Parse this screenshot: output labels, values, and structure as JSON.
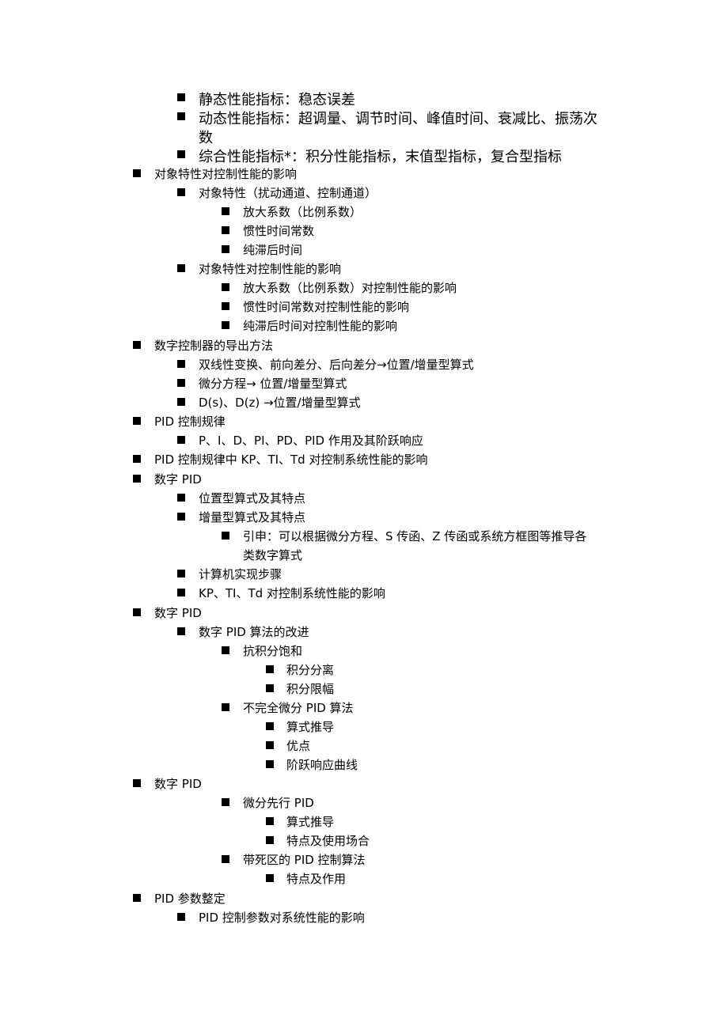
{
  "outline": [
    {
      "level": 2,
      "size": "big",
      "text": "静态性能指标：稳态误差"
    },
    {
      "level": 2,
      "size": "big",
      "text": "动态性能指标：超调量、调节时间、峰值时间、衰减比、振荡次",
      "continuation": "数"
    },
    {
      "level": 2,
      "size": "big",
      "text": "综合性能指标*：积分性能指标，末值型指标，复合型指标"
    },
    {
      "level": 1,
      "size": "small",
      "text": "对象特性对控制性能的影响"
    },
    {
      "level": 2,
      "size": "small",
      "text": "对象特性（扰动通道、控制通道）"
    },
    {
      "level": 3,
      "size": "small",
      "text": "放大系数（比例系数）"
    },
    {
      "level": 3,
      "size": "small",
      "text": "惯性时间常数"
    },
    {
      "level": 3,
      "size": "small",
      "text": "纯滞后时间"
    },
    {
      "level": 2,
      "size": "small",
      "text": "对象特性对控制性能的影响"
    },
    {
      "level": 3,
      "size": "small",
      "text": "放大系数（比例系数）对控制性能的影响"
    },
    {
      "level": 3,
      "size": "small",
      "text": "惯性时间常数对控制性能的影响"
    },
    {
      "level": 3,
      "size": "small",
      "text": "纯滞后时间对控制性能的影响"
    },
    {
      "level": 1,
      "size": "small",
      "text": "数字控制器的导出方法"
    },
    {
      "level": 2,
      "size": "small",
      "text": "双线性变换、前向差分、后向差分→位置/增量型算式"
    },
    {
      "level": 2,
      "size": "small",
      "text": "微分方程→ 位置/增量型算式"
    },
    {
      "level": 2,
      "size": "small",
      "text": "D(s)、D(z) →位置/增量型算式"
    },
    {
      "level": 1,
      "size": "small",
      "text": "PID 控制规律"
    },
    {
      "level": 2,
      "size": "small",
      "text": "P、I、D、PI、PD、PID 作用及其阶跃响应"
    },
    {
      "level": 1,
      "size": "small",
      "text": "PID 控制规律中 KP、TI、Td 对控制系统性能的影响"
    },
    {
      "level": 1,
      "size": "small",
      "text": "数字 PID"
    },
    {
      "level": 2,
      "size": "small",
      "text": "位置型算式及其特点"
    },
    {
      "level": 2,
      "size": "small",
      "text": "增量型算式及其特点"
    },
    {
      "level": 3,
      "size": "small",
      "text": "引申：可以根据微分方程、S 传函、Z 传函或系统方框图等推导各",
      "continuation": "类数字算式"
    },
    {
      "level": 2,
      "size": "small",
      "text": "计算机实现步骤"
    },
    {
      "level": 2,
      "size": "small",
      "text": "KP、TI、Td 对控制系统性能的影响"
    },
    {
      "level": 1,
      "size": "small",
      "text": "数字 PID"
    },
    {
      "level": 2,
      "size": "small",
      "text": "数字 PID 算法的改进"
    },
    {
      "level": 3,
      "size": "small",
      "text": "抗积分饱和"
    },
    {
      "level": 4,
      "size": "small",
      "text": "积分分离"
    },
    {
      "level": 4,
      "size": "small",
      "text": "积分限幅"
    },
    {
      "level": 3,
      "size": "small",
      "text": "不完全微分 PID 算法"
    },
    {
      "level": 4,
      "size": "small",
      "text": "算式推导"
    },
    {
      "level": 4,
      "size": "small",
      "text": "优点"
    },
    {
      "level": 4,
      "size": "small",
      "text": "阶跃响应曲线"
    },
    {
      "level": 1,
      "size": "small",
      "text": "数字 PID"
    },
    {
      "level": 3,
      "size": "small",
      "text": "微分先行 PID"
    },
    {
      "level": 4,
      "size": "small",
      "text": "算式推导"
    },
    {
      "level": 4,
      "size": "small",
      "text": "特点及使用场合"
    },
    {
      "level": 3,
      "size": "small",
      "text": "带死区的 PID 控制算法"
    },
    {
      "level": 4,
      "size": "small",
      "text": "特点及作用"
    },
    {
      "level": 1,
      "size": "small",
      "text": "PID 参数整定"
    },
    {
      "level": 2,
      "size": "small",
      "text": "PID 控制参数对系统性能的影响"
    }
  ]
}
